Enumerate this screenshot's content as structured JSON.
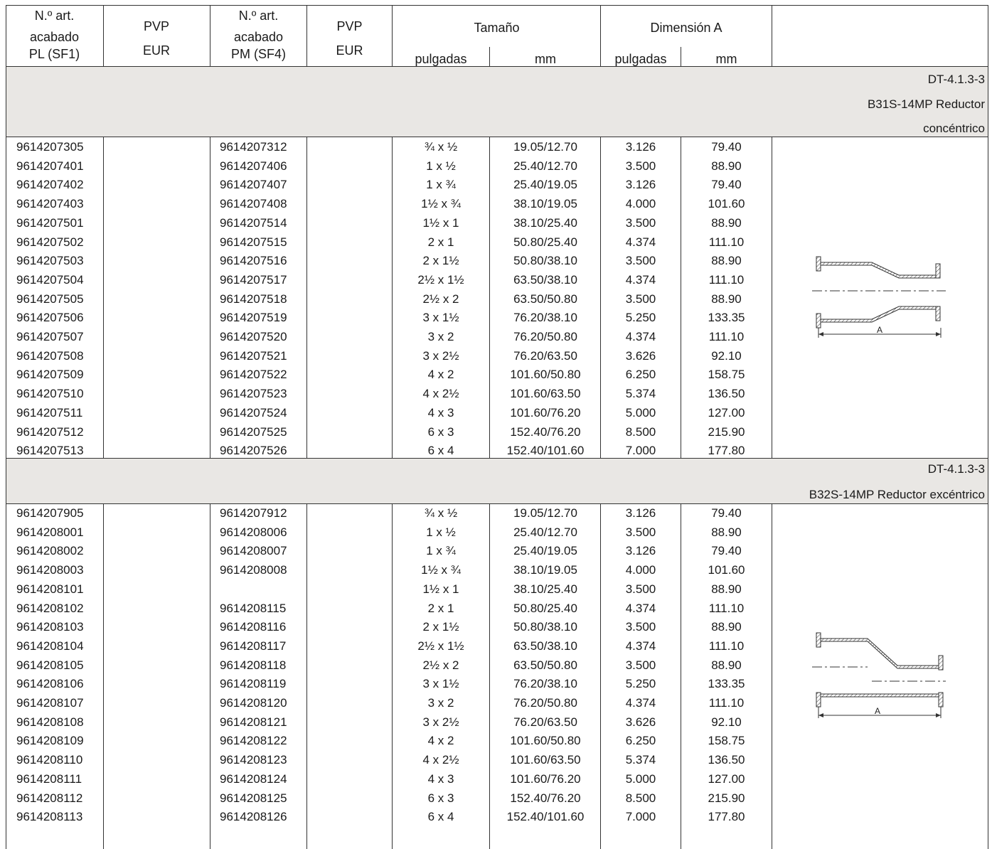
{
  "header": {
    "col1": [
      "N.º art.",
      "acabado",
      "PL (SF1)"
    ],
    "col2": [
      "PVP",
      "EUR"
    ],
    "col3": [
      "N.º art.",
      "acabado",
      "PM (SF4)"
    ],
    "col4": [
      "PVP",
      "EUR"
    ],
    "size": "Tamaño",
    "size_in": "pulgadas",
    "size_mm": "mm",
    "dim": "Dimensión A",
    "dim_in": "pulgadas",
    "dim_mm": "mm"
  },
  "sections": [
    {
      "ref": "DT-4.1.3-3",
      "title_lines": [
        "B31S-14MP  Reductor",
        "concéntrico"
      ],
      "diagram_label": "A",
      "rows": [
        [
          "9614207305",
          "",
          "9614207312",
          "",
          "¾ x ½",
          "19.05/12.70",
          "3.126",
          "79.40"
        ],
        [
          "9614207401",
          "",
          "9614207406",
          "",
          "1 x ½",
          "25.40/12.70",
          "3.500",
          "88.90"
        ],
        [
          "9614207402",
          "",
          "9614207407",
          "",
          "1 x ¾",
          "25.40/19.05",
          "3.126",
          "79.40"
        ],
        [
          "9614207403",
          "",
          "9614207408",
          "",
          "1½ x ¾",
          "38.10/19.05",
          "4.000",
          "101.60"
        ],
        [
          "9614207501",
          "",
          "9614207514",
          "",
          "1½ x 1",
          "38.10/25.40",
          "3.500",
          "88.90"
        ],
        [
          "9614207502",
          "",
          "9614207515",
          "",
          "2 x 1",
          "50.80/25.40",
          "4.374",
          "111.10"
        ],
        [
          "9614207503",
          "",
          "9614207516",
          "",
          "2 x 1½",
          "50.80/38.10",
          "3.500",
          "88.90"
        ],
        [
          "9614207504",
          "",
          "9614207517",
          "",
          "2½ x 1½",
          "63.50/38.10",
          "4.374",
          "111.10"
        ],
        [
          "9614207505",
          "",
          "9614207518",
          "",
          "2½ x 2",
          "63.50/50.80",
          "3.500",
          "88.90"
        ],
        [
          "9614207506",
          "",
          "9614207519",
          "",
          "3 x 1½",
          "76.20/38.10",
          "5.250",
          "133.35"
        ],
        [
          "9614207507",
          "",
          "9614207520",
          "",
          "3 x 2",
          "76.20/50.80",
          "4.374",
          "111.10"
        ],
        [
          "9614207508",
          "",
          "9614207521",
          "",
          "3 x 2½",
          "76.20/63.50",
          "3.626",
          "92.10"
        ],
        [
          "9614207509",
          "",
          "9614207522",
          "",
          "4 x 2",
          "101.60/50.80",
          "6.250",
          "158.75"
        ],
        [
          "9614207510",
          "",
          "9614207523",
          "",
          "4 x 2½",
          "101.60/63.50",
          "5.374",
          "136.50"
        ],
        [
          "9614207511",
          "",
          "9614207524",
          "",
          "4 x 3",
          "101.60/76.20",
          "5.000",
          "127.00"
        ],
        [
          "9614207512",
          "",
          "9614207525",
          "",
          "6 x 3",
          "152.40/76.20",
          "8.500",
          "215.90"
        ],
        [
          "9614207513",
          "",
          "9614207526",
          "",
          "6 x 4",
          "152.40/101.60",
          "7.000",
          "177.80"
        ]
      ]
    },
    {
      "ref": "DT-4.1.3-3",
      "title_lines": [
        "B32S-14MP Reductor excéntrico"
      ],
      "diagram_label": "A",
      "rows": [
        [
          "9614207905",
          "",
          "9614207912",
          "",
          "¾ x ½",
          "19.05/12.70",
          "3.126",
          "79.40"
        ],
        [
          "9614208001",
          "",
          "9614208006",
          "",
          "1 x ½",
          "25.40/12.70",
          "3.500",
          "88.90"
        ],
        [
          "9614208002",
          "",
          "9614208007",
          "",
          "1 x ¾",
          "25.40/19.05",
          "3.126",
          "79.40"
        ],
        [
          "9614208003",
          "",
          "9614208008",
          "",
          "1½ x ¾",
          "38.10/19.05",
          "4.000",
          "101.60"
        ],
        [
          "9614208101",
          "",
          "",
          "",
          "1½ x 1",
          "38.10/25.40",
          "3.500",
          "88.90"
        ],
        [
          "9614208102",
          "",
          "9614208115",
          "",
          "2 x 1",
          "50.80/25.40",
          "4.374",
          "111.10"
        ],
        [
          "9614208103",
          "",
          "9614208116",
          "",
          "2 x 1½",
          "50.80/38.10",
          "3.500",
          "88.90"
        ],
        [
          "9614208104",
          "",
          "9614208117",
          "",
          "2½ x 1½",
          "63.50/38.10",
          "4.374",
          "111.10"
        ],
        [
          "9614208105",
          "",
          "9614208118",
          "",
          "2½ x 2",
          "63.50/50.80",
          "3.500",
          "88.90"
        ],
        [
          "9614208106",
          "",
          "9614208119",
          "",
          "3 x 1½",
          "76.20/38.10",
          "5.250",
          "133.35"
        ],
        [
          "9614208107",
          "",
          "9614208120",
          "",
          "3 x 2",
          "76.20/50.80",
          "4.374",
          "111.10"
        ],
        [
          "9614208108",
          "",
          "9614208121",
          "",
          "3 x 2½",
          "76.20/63.50",
          "3.626",
          "92.10"
        ],
        [
          "9614208109",
          "",
          "9614208122",
          "",
          "4 x 2",
          "101.60/50.80",
          "6.250",
          "158.75"
        ],
        [
          "9614208110",
          "",
          "9614208123",
          "",
          "4 x 2½",
          "101.60/63.50",
          "5.374",
          "136.50"
        ],
        [
          "9614208111",
          "",
          "9614208124",
          "",
          "4 x 3",
          "101.60/76.20",
          "5.000",
          "127.00"
        ],
        [
          "9614208112",
          "",
          "9614208125",
          "",
          "6 x 3",
          "152.40/76.20",
          "8.500",
          "215.90"
        ],
        [
          "9614208113",
          "",
          "9614208126",
          "",
          "6 x 4",
          "152.40/101.60",
          "7.000",
          "177.80"
        ]
      ]
    }
  ]
}
